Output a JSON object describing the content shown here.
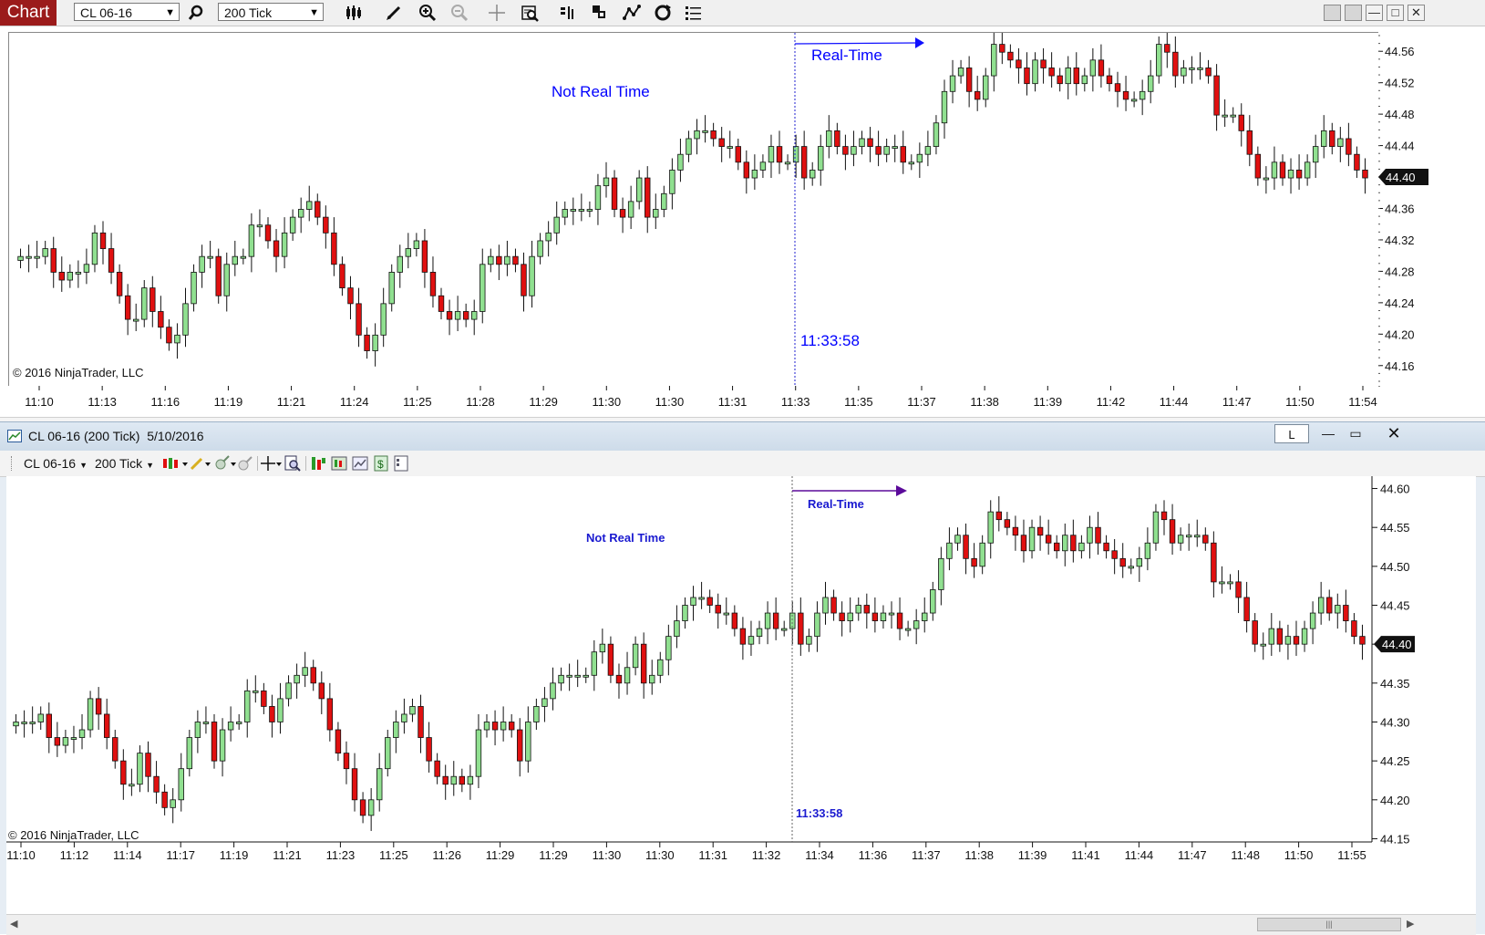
{
  "top_window": {
    "tab_label": "Chart",
    "instrument": "CL 06-16",
    "interval": "200 Tick",
    "annotations": {
      "not_real_time": "Not Real Time",
      "real_time": "Real-Time",
      "divider_time": "11:33:58",
      "copyright": "© 2016 NinjaTrader, LLC"
    },
    "price_axis": [
      "44.56",
      "44.52",
      "44.48",
      "44.44",
      "44.40",
      "44.36",
      "44.32",
      "44.28",
      "44.24",
      "44.20",
      "44.16"
    ],
    "current_price": "44.40",
    "time_axis": [
      "11:10",
      "11:13",
      "11:16",
      "11:19",
      "11:21",
      "11:24",
      "11:25",
      "11:28",
      "11:29",
      "11:30",
      "11:30",
      "11:31",
      "11:33",
      "11:35",
      "11:37",
      "11:38",
      "11:39",
      "11:42",
      "11:44",
      "11:47",
      "11:50",
      "11:54"
    ],
    "toolbar_icons": [
      "search-icon",
      "bar-type-icon",
      "pencil-icon",
      "zoom-in-icon",
      "zoom-out-icon",
      "crosshair-icon",
      "data-box-icon",
      "order-icon",
      "properties-icon",
      "strategy-icon",
      "reload-icon",
      "list-icon"
    ],
    "colors": {
      "tab": "#9b1b1b",
      "annotation": "#0000ff",
      "up": "#90e090",
      "down": "#e01010"
    }
  },
  "bottom_window": {
    "title": "CL 06-16 (200 Tick)  5/10/2016",
    "instrument": "CL 06-16",
    "interval": "200 Tick",
    "link_button": "L",
    "annotations": {
      "not_real_time": "Not Real Time",
      "real_time": "Real-Time",
      "divider_time": "11:33:58",
      "copyright": "© 2016 NinjaTrader, LLC"
    },
    "price_axis": [
      "44.60",
      "44.55",
      "44.50",
      "44.45",
      "44.40",
      "44.35",
      "44.30",
      "44.25",
      "44.20",
      "44.15"
    ],
    "current_price": "44.40",
    "time_axis": [
      "11:10",
      "11:12",
      "11:14",
      "11:17",
      "11:19",
      "11:21",
      "11:23",
      "11:25",
      "11:26",
      "11:29",
      "11:29",
      "11:30",
      "11:30",
      "11:31",
      "11:32",
      "11:34",
      "11:36",
      "11:37",
      "11:38",
      "11:39",
      "11:41",
      "11:44",
      "11:47",
      "11:48",
      "11:50",
      "11:55"
    ],
    "colors": {
      "annotation": "#1a1ad0",
      "arrow": "#5b0a9a",
      "up": "#90e090",
      "down": "#e01010"
    }
  },
  "chart_data": [
    {
      "type": "candlestick",
      "title": "CL 06-16 200 Tick",
      "ylim": [
        44.14,
        44.58
      ],
      "closes": [
        44.3,
        44.3,
        44.3,
        44.31,
        44.28,
        44.27,
        44.28,
        44.28,
        44.29,
        44.33,
        44.31,
        44.28,
        44.25,
        44.22,
        44.22,
        44.26,
        44.23,
        44.21,
        44.19,
        44.2,
        44.24,
        44.28,
        44.3,
        44.3,
        44.25,
        44.29,
        44.3,
        44.3,
        44.34,
        44.34,
        44.32,
        44.3,
        44.33,
        44.35,
        44.36,
        44.37,
        44.35,
        44.33,
        44.29,
        44.26,
        44.24,
        44.2,
        44.18,
        44.2,
        44.24,
        44.28,
        44.3,
        44.31,
        44.32,
        44.28,
        44.25,
        44.23,
        44.22,
        44.23,
        44.22,
        44.23,
        44.29,
        44.3,
        44.29,
        44.3,
        44.29,
        44.25,
        44.3,
        44.32,
        44.33,
        44.35,
        44.36,
        44.36,
        44.36,
        44.36,
        44.39,
        44.4,
        44.36,
        44.35,
        44.37,
        44.4,
        44.35,
        44.36,
        44.38,
        44.41,
        44.43,
        44.45,
        44.46,
        44.46,
        44.45,
        44.44,
        44.44,
        44.42,
        44.4,
        44.41,
        44.42,
        44.44,
        44.42,
        44.42,
        44.44,
        44.4,
        44.41,
        44.44,
        44.46,
        44.44,
        44.43,
        44.44,
        44.45,
        44.44,
        44.43,
        44.44,
        44.44,
        44.42,
        44.42,
        44.43,
        44.44,
        44.47,
        44.51,
        44.53,
        44.54,
        44.51,
        44.5,
        44.53,
        44.57,
        44.56,
        44.55,
        44.54,
        44.52,
        44.55,
        44.54,
        44.53,
        44.52,
        44.54,
        44.52,
        44.53,
        44.55,
        44.53,
        44.52,
        44.51,
        44.5,
        44.5,
        44.51,
        44.53,
        44.57,
        44.56,
        44.53,
        44.54,
        44.54,
        44.54,
        44.53,
        44.48,
        44.48,
        44.48,
        44.46,
        44.43,
        44.4,
        44.4,
        44.42,
        44.4,
        44.41,
        44.4,
        44.42,
        44.44,
        44.46,
        44.44,
        44.45,
        44.43,
        44.41,
        44.4
      ]
    },
    {
      "type": "candlestick",
      "title": "CL 06-16 (200 Tick) 5/10/2016",
      "ylim": [
        44.14,
        44.61
      ],
      "closes": [
        44.3,
        44.3,
        44.3,
        44.31,
        44.28,
        44.27,
        44.28,
        44.28,
        44.29,
        44.33,
        44.31,
        44.28,
        44.25,
        44.22,
        44.22,
        44.26,
        44.23,
        44.21,
        44.19,
        44.2,
        44.24,
        44.28,
        44.3,
        44.3,
        44.25,
        44.29,
        44.3,
        44.3,
        44.34,
        44.34,
        44.32,
        44.3,
        44.33,
        44.35,
        44.36,
        44.37,
        44.35,
        44.33,
        44.29,
        44.26,
        44.24,
        44.2,
        44.18,
        44.2,
        44.24,
        44.28,
        44.3,
        44.31,
        44.32,
        44.28,
        44.25,
        44.23,
        44.22,
        44.23,
        44.22,
        44.23,
        44.29,
        44.3,
        44.29,
        44.3,
        44.29,
        44.25,
        44.3,
        44.32,
        44.33,
        44.35,
        44.36,
        44.36,
        44.36,
        44.36,
        44.39,
        44.4,
        44.36,
        44.35,
        44.37,
        44.4,
        44.35,
        44.36,
        44.38,
        44.41,
        44.43,
        44.45,
        44.46,
        44.46,
        44.45,
        44.44,
        44.44,
        44.42,
        44.4,
        44.41,
        44.42,
        44.44,
        44.42,
        44.42,
        44.44,
        44.4,
        44.41,
        44.44,
        44.46,
        44.44,
        44.43,
        44.44,
        44.45,
        44.44,
        44.43,
        44.44,
        44.44,
        44.42,
        44.42,
        44.43,
        44.44,
        44.47,
        44.51,
        44.53,
        44.54,
        44.51,
        44.5,
        44.53,
        44.57,
        44.56,
        44.55,
        44.54,
        44.52,
        44.55,
        44.54,
        44.53,
        44.52,
        44.54,
        44.52,
        44.53,
        44.55,
        44.53,
        44.52,
        44.51,
        44.5,
        44.5,
        44.51,
        44.53,
        44.57,
        44.56,
        44.53,
        44.54,
        44.54,
        44.54,
        44.53,
        44.48,
        44.48,
        44.48,
        44.46,
        44.43,
        44.4,
        44.4,
        44.42,
        44.4,
        44.41,
        44.4,
        44.42,
        44.44,
        44.46,
        44.44,
        44.45,
        44.43,
        44.41,
        44.4
      ]
    }
  ]
}
